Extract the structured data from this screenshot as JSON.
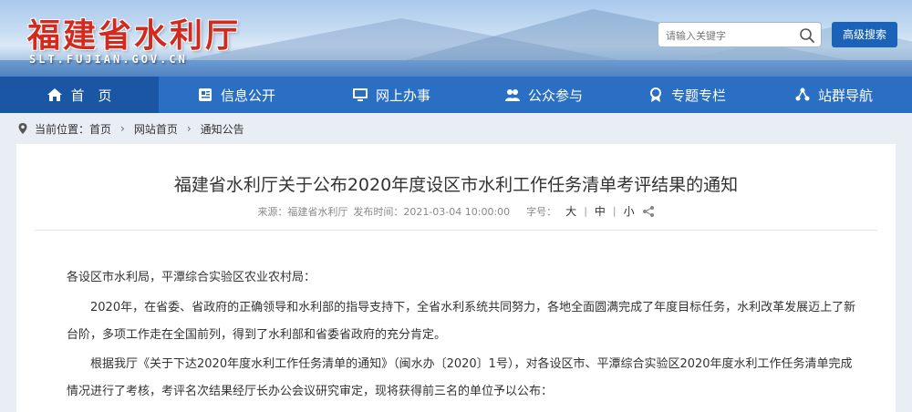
{
  "header": {
    "site_title": "福建省水利厅",
    "site_domain": "SLT.FUJIAN.GOV.CN",
    "search_placeholder": "请输入关键字",
    "advanced_search_label": "高级搜索"
  },
  "nav": {
    "items": [
      {
        "label": "首　页",
        "icon": "home-icon"
      },
      {
        "label": "信息公开",
        "icon": "info-icon"
      },
      {
        "label": "网上办事",
        "icon": "monitor-icon"
      },
      {
        "label": "公众参与",
        "icon": "people-icon"
      },
      {
        "label": "专题专栏",
        "icon": "badge-icon"
      },
      {
        "label": "站群导航",
        "icon": "network-icon"
      }
    ]
  },
  "breadcrumb": {
    "prefix": "当前位置：",
    "items": [
      "首页",
      "网站首页",
      "通知公告"
    ],
    "separator": "›"
  },
  "article": {
    "title": "福建省水利厅关于公布2020年度设区市水利工作任务清单考评结果的通知",
    "source": "来源：福建省水利厅",
    "published": "发布时间：2021-03-04 10:00:00",
    "font_size_label": "字号：",
    "font_sizes": [
      "大",
      "中",
      "小"
    ],
    "paragraphs": [
      "各设区市水利局，平潭综合实验区农业农村局：",
      "2020年，在省委、省政府的正确领导和水利部的指导支持下，全省水利系统共同努力，各地全面圆满完成了年度目标任务，水利改革发展迈上了新台阶，多项工作走在全国前列，得到了水利部和省委省政府的充分肯定。",
      "根据我厅《关于下达2020年度水利工作任务清单的通知》（闽水办〔2020〕1号），对各设区市、平潭综合实验区2020年度水利工作任务清单完成情况进行了考核，考评名次结果经厅长办公会议研究审定，现将获得前三名的单位予以公布："
    ]
  },
  "colors": {
    "nav_bg": "#2a6fc4",
    "nav_active": "#1a56a3",
    "title_red": "#d32a1f",
    "button_blue": "#1b63b8"
  }
}
